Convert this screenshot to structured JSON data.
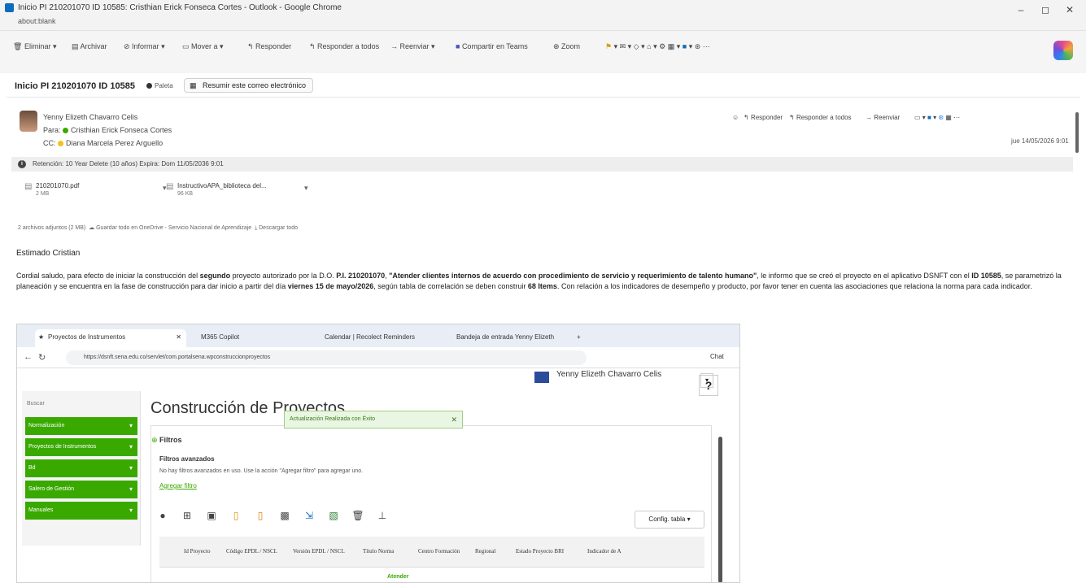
{
  "window": {
    "title": "Inicio PI 210201070 ID 10585: Cristhian Erick Fonseca Cortes - Outlook - Google Chrome",
    "url": "about:blank",
    "minimize": "–",
    "restore": "◻",
    "close": "✕"
  },
  "ribbon": {
    "items": [
      {
        "label": "Eliminar",
        "icon": "trash-icon"
      },
      {
        "label": "Archivar",
        "icon": "archive-icon"
      },
      {
        "label": "Informar",
        "icon": "report-icon"
      },
      {
        "label": "Mover a",
        "icon": "folder-move-icon"
      },
      {
        "label": "Responder",
        "icon": "reply-icon"
      },
      {
        "label": "Responder a todos",
        "icon": "reply-all-icon"
      },
      {
        "label": "Reenviar",
        "icon": "forward-icon"
      },
      {
        "label": "Compartir en Teams",
        "icon": "teams-icon"
      },
      {
        "label": "Zoom",
        "icon": "zoom-icon"
      }
    ]
  },
  "subject": {
    "title": "Inicio PI 210201070 ID 10585",
    "tag": "Paleta",
    "summarize": "Resumir este correo electrónico"
  },
  "message": {
    "sender": "Yenny Elizeth Chavarro Celis",
    "to_label": "Para:",
    "to": "Cristhian Erick Fonseca Cortes",
    "cc_label": "CC:",
    "cc": "Diana Marcela Perez Arguello",
    "actions": {
      "reply": "Responder",
      "reply_all": "Responder a todos",
      "forward": "Reenviar"
    },
    "date": "jue 14/05/2026 9:01",
    "retention": "Retención: 10 Year Delete (10 años) Expira: Dom 11/05/2036 9:01"
  },
  "attachments": {
    "items": [
      {
        "name": "210201070.pdf",
        "size": "2 MB"
      },
      {
        "name": "InstructivoAPA_biblioteca del...",
        "size": "96 KB"
      }
    ],
    "summary": "2 archivos adjuntos (2 MB)",
    "save_onedrive": "Guardar todo en OneDrive - Servicio Nacional de Aprendizaje",
    "download_all": "Descargar todo"
  },
  "body": {
    "greeting": "Estimado Cristian",
    "p1": "Cordial saludo, para efecto de iniciar la construcción del ",
    "p1_b1": "segundo",
    "p2": " proyecto autorizado por la D.O. ",
    "p2_b": "P.I. 210201070",
    "p3": ", ",
    "p3_b": "\"Atender clientes internos de acuerdo con procedimiento de servicio y requerimiento de talento humano\"",
    "p4": ", le informo que se creó el proyecto en el aplicativo DSNFT con el ",
    "p4_b": "ID 10585",
    "p5": ", se parametrizó la planeación y se encuentra en la fase de construcción para dar inicio a partir del día ",
    "p5_b": "viernes 15 de mayo/2026",
    "p6": ", según tabla de correlación se deben construir ",
    "p6_b": "68 Items",
    "p7": ". Con relación a los indicadores de desempeño y producto, por favor tener en cuenta las asociaciones que relaciona la norma para cada indicador."
  },
  "shot": {
    "tabs": [
      "Proyectos de Instrumentos",
      "M365 Copilot",
      "Calendar | Recolect Reminders",
      "Bandeja de entrada Yenny Elizeth"
    ],
    "address": "https://dsnft.sena.edu.co/servlet/com.portalsena.wpconstruccionproyectos",
    "chat": "Chat",
    "user": "Yenny Elizeth Chavarro Celis",
    "search": "Buscar",
    "menu": [
      "Normalización",
      "Proyectos de Instrumentos",
      "Bd",
      "Salero de Gestión",
      "Manuales"
    ],
    "page_title": "Construcción de Proyectos",
    "help": "?",
    "toast": "Actualización Realizada con Éxito",
    "filters": "Filtros",
    "advanced": "Filtros avanzados",
    "none": "No hay filtros avanzados en uso. Use la acción \"Agregar filtro\" para agregar uno.",
    "add_filter": "Agregar filtro",
    "config": "Config. tabla ▾",
    "columns": [
      "Id Proyecto",
      "Código EPDL / NSCL",
      "Versión EPDL / NSCL",
      "Título Norma",
      "Centro Formación",
      "Regional",
      "Estado Proyecto BRI",
      "Indicador de A"
    ],
    "first_cell": "Atender"
  }
}
